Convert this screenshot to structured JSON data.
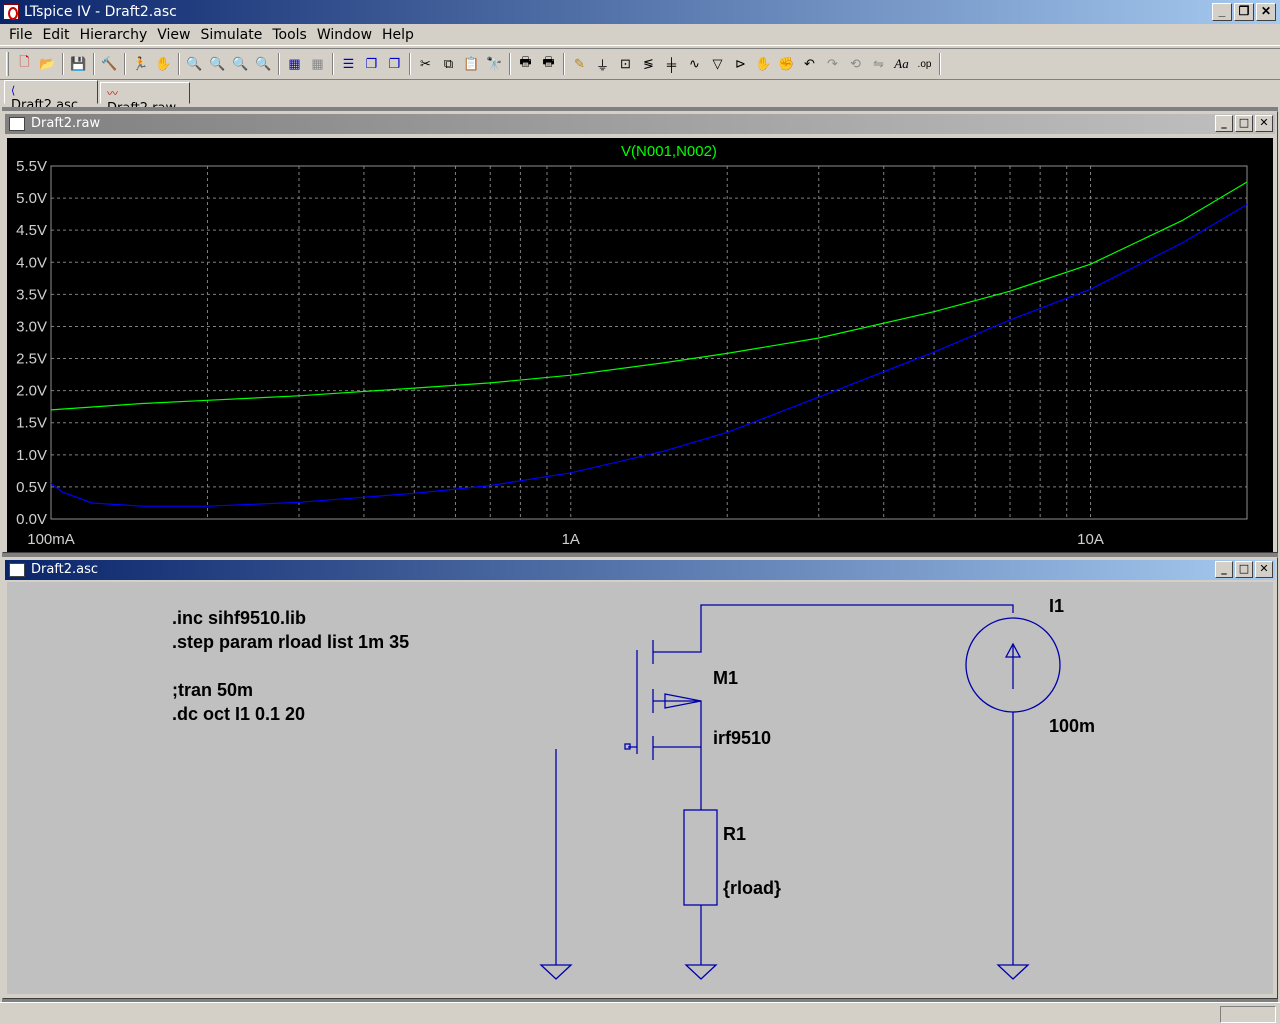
{
  "window": {
    "title": "LTspice IV - Draft2.asc"
  },
  "menu": [
    "File",
    "Edit",
    "Hierarchy",
    "View",
    "Simulate",
    "Tools",
    "Window",
    "Help"
  ],
  "toolbar": {
    "tools": [
      "new-schematic",
      "open",
      "save",
      "control-panel",
      "run",
      "halt",
      "zoom-in",
      "zoom-pan",
      "zoom-out",
      "zoom-cancel",
      "autorange",
      "view-grid",
      "tile-horizontal",
      "cascade",
      "close-all",
      "cut",
      "copy",
      "paste",
      "find",
      "print-setup",
      "print",
      "draw-wire",
      "ground",
      "label-net",
      "resistor",
      "capacitor",
      "inductor",
      "diode",
      "component",
      "move",
      "drag",
      "undo",
      "redo",
      "rotate",
      "mirror",
      "text",
      "spice-directive"
    ],
    "spice_directive_label": ".op",
    "text_label": "Aa"
  },
  "tabs": [
    {
      "label": "Draft2.asc",
      "active": true
    },
    {
      "label": "Draft2.raw",
      "active": false
    }
  ],
  "waveform_window": {
    "title": "Draft2.raw"
  },
  "schematic_window": {
    "title": "Draft2.asc"
  },
  "chart_data": {
    "type": "line",
    "title": "V(N001,N002)",
    "x_scale": "log",
    "xlim": [
      0.1,
      20
    ],
    "ylim": [
      0,
      5.5
    ],
    "x_ticks": [
      {
        "value": 0.1,
        "label": "100mA"
      },
      {
        "value": 1,
        "label": "1A"
      },
      {
        "value": 10,
        "label": "10A"
      }
    ],
    "y_ticks": [
      "0.0V",
      "0.5V",
      "1.0V",
      "1.5V",
      "2.0V",
      "2.5V",
      "3.0V",
      "3.5V",
      "4.0V",
      "4.5V",
      "5.0V",
      "5.5V"
    ],
    "grid": true,
    "series": [
      {
        "color": "#00ff00",
        "x": [
          0.1,
          0.15,
          0.2,
          0.3,
          0.5,
          0.7,
          1,
          1.5,
          2,
          3,
          5,
          7,
          10,
          15,
          20
        ],
        "values": [
          1.7,
          1.8,
          1.85,
          1.92,
          2.04,
          2.12,
          2.24,
          2.43,
          2.58,
          2.82,
          3.23,
          3.55,
          3.97,
          4.65,
          5.25
        ]
      },
      {
        "color": "#0000ff",
        "x": [
          0.1,
          0.105,
          0.12,
          0.15,
          0.2,
          0.3,
          0.5,
          0.7,
          1,
          1.5,
          2,
          3,
          5,
          7,
          10,
          15,
          20
        ],
        "values": [
          0.56,
          0.42,
          0.25,
          0.2,
          0.2,
          0.26,
          0.4,
          0.52,
          0.72,
          1.05,
          1.35,
          1.9,
          2.6,
          3.1,
          3.58,
          4.3,
          4.9
        ]
      }
    ]
  },
  "schematic": {
    "directives": [
      ".inc sihf9510.lib",
      ".step param rload list 1m 35",
      "",
      ";tran 50m",
      ".dc oct I1 0.1 20"
    ],
    "m1_name": "M1",
    "m1_model": "irf9510",
    "r1_name": "R1",
    "r1_value": "{rload}",
    "i1_name": "I1",
    "i1_value": "100m",
    "wire_color": "#0000aa"
  }
}
